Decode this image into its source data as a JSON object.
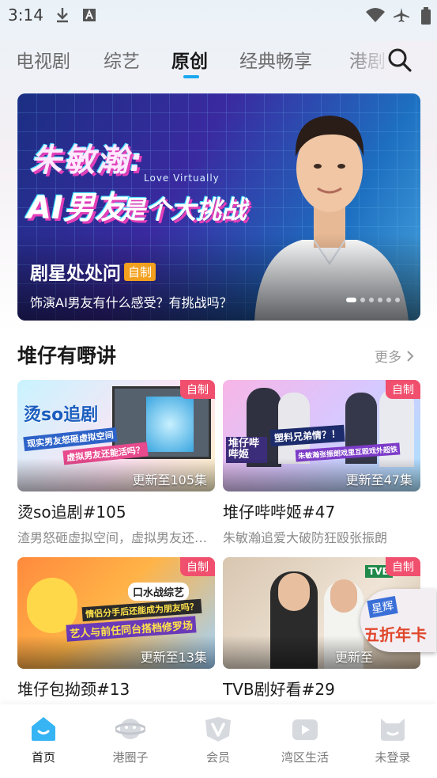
{
  "status_bar": {
    "time": "3:14",
    "icons": [
      "download-icon",
      "a-notification-icon",
      "wifi-icon",
      "airplane-icon",
      "battery-icon"
    ]
  },
  "tabs": [
    {
      "label": "电视剧",
      "active": false
    },
    {
      "label": "综艺",
      "active": false
    },
    {
      "label": "原创",
      "active": true
    },
    {
      "label": "经典畅享",
      "active": false
    },
    {
      "label": "港剧",
      "active": false
    }
  ],
  "banner": {
    "headline_name": "朱敏瀚:",
    "headline_en": "Love Virtually",
    "headline_ai": "AI男友",
    "headline_rest": "是个大挑战",
    "title": "剧星处处问",
    "tag": "自制",
    "description": "饰演AI男友有什么感受？有挑战吗？",
    "dot_count": 6,
    "active_dot": 0
  },
  "section": {
    "title": "堆仔有嘢讲",
    "more": "更多"
  },
  "cards": [
    {
      "badge": "自制",
      "episode": "更新至105集",
      "title": "烫so追剧#105",
      "description": "渣男怒砸虚拟空间，虚拟男友还能活吗？",
      "thumb_logo": "烫so追剧",
      "thumb_caption1": "现实男友怒砸虚拟空间",
      "thumb_caption2": "虚拟男友还能活吗？"
    },
    {
      "badge": "自制",
      "episode": "更新至47集",
      "title": "堆仔哔哔姬#47",
      "description": "朱敏瀚追爱大破防狂殴张振朗",
      "thumb_logo": "堆仔哔哔姬",
      "thumb_caption1": "塑料兄弟情？！",
      "thumb_caption2": "朱敏瀚张振朗戏里互殴戏外超铁"
    },
    {
      "badge": "自制",
      "episode": "更新至13集",
      "title": "堆仔包拗颈#13",
      "description": "",
      "thumb_logo": "口水战综艺",
      "thumb_caption1": "情侣分手后还能成为朋友吗？",
      "thumb_caption2": "艺人与前任同台搭档修罗场"
    },
    {
      "badge": "自制",
      "episode": "更新至",
      "title": "TVB剧好看#29",
      "description": "",
      "thumb_logo": "TVB"
    }
  ],
  "promo": {
    "line1": "星辉",
    "line2": "五折年卡"
  },
  "bottom_nav": [
    {
      "label": "首页",
      "icon": "home-icon",
      "active": true
    },
    {
      "label": "港圈子",
      "icon": "planet-icon",
      "active": false
    },
    {
      "label": "会员",
      "icon": "vip-icon",
      "active": false
    },
    {
      "label": "湾区生活",
      "icon": "video-icon",
      "active": false
    },
    {
      "label": "未登录",
      "icon": "user-icon",
      "active": false
    }
  ],
  "colors": {
    "accent": "#19a8f0",
    "badge": "#f0506e",
    "tag": "#f2a01e"
  }
}
